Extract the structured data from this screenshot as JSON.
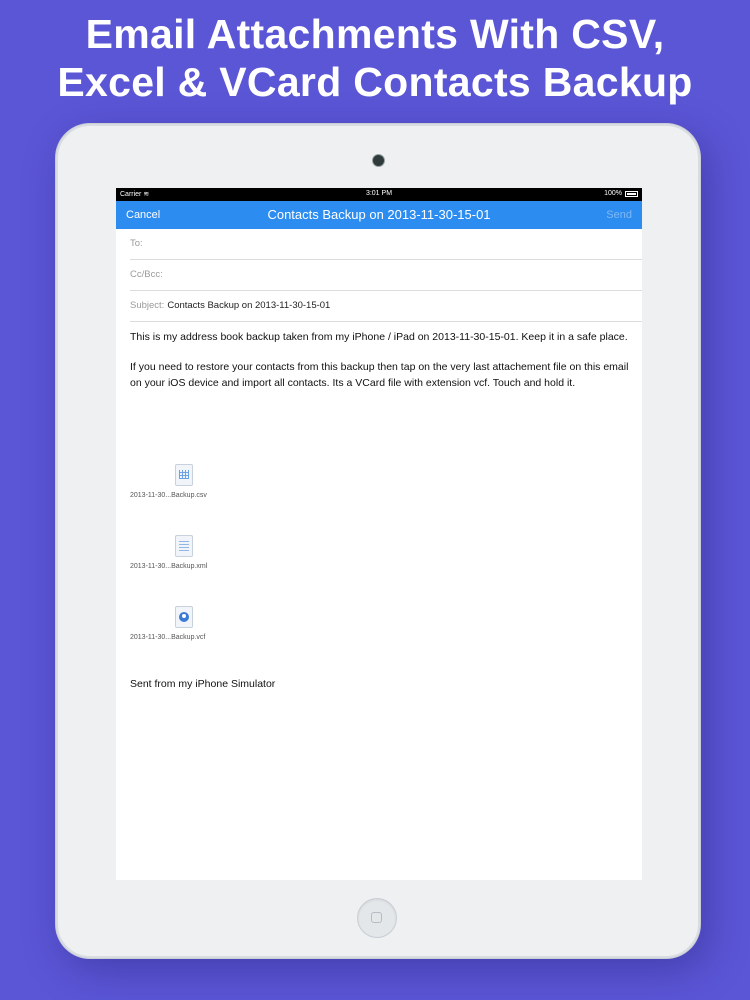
{
  "headline": {
    "line1": "Email Attachments With CSV,",
    "line2": "Excel & VCard Contacts Backup"
  },
  "status_bar": {
    "carrier": "Carrier",
    "time": "3:01 PM",
    "battery": "100%"
  },
  "nav": {
    "cancel": "Cancel",
    "title": "Contacts Backup on 2013-11-30-15-01",
    "send": "Send"
  },
  "fields": {
    "to_label": "To:",
    "ccbcc_label": "Cc/Bcc:",
    "subject_label": "Subject:",
    "subject_value": "Contacts Backup on 2013-11-30-15-01"
  },
  "body": {
    "paragraph1": "This is my address book backup taken from my iPhone / iPad on 2013-11-30-15-01. Keep it in a safe place.",
    "paragraph2": "If you need to restore your contacts from this backup then tap on the very last attachement file on this email on your iOS device and import all contacts. Its a VCard file with extension vcf. Touch and hold it."
  },
  "attachments": [
    {
      "name": "2013-11-30...Backup.csv",
      "icon": "spreadsheet-file-icon"
    },
    {
      "name": "2013-11-30...Backup.xml",
      "icon": "text-file-icon"
    },
    {
      "name": "2013-11-30...Backup.vcf",
      "icon": "contact-card-file-icon"
    }
  ],
  "signature": "Sent from my iPhone Simulator",
  "colors": {
    "background": "#5b56d6",
    "nav_bar": "#2d8cf0",
    "send_disabled": "#7fb9f5"
  }
}
